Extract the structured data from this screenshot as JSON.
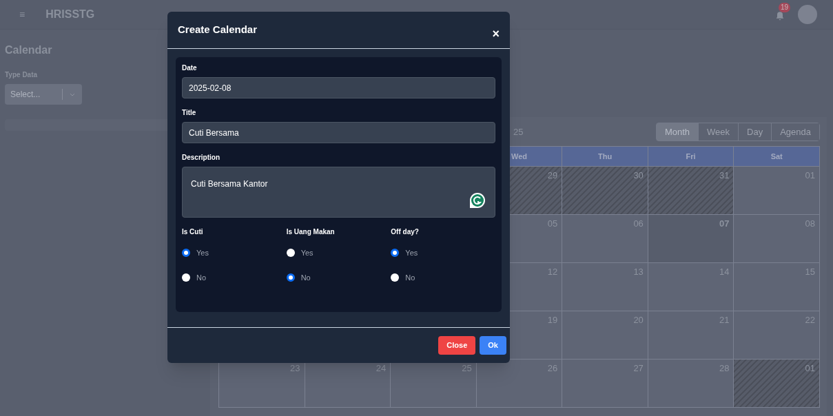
{
  "header": {
    "menu_glyph": "≡",
    "brand": "HRISSTG",
    "notification_count": "19"
  },
  "page": {
    "title": "Calendar",
    "filter_label": "Type Data",
    "filter_placeholder": "Select..."
  },
  "calendar": {
    "label": "25",
    "views": [
      {
        "label": "Month",
        "selected": true
      },
      {
        "label": "Week",
        "selected": false
      },
      {
        "label": "Day",
        "selected": false
      },
      {
        "label": "Agenda",
        "selected": false
      }
    ],
    "weekdays": [
      {
        "label": "Wed"
      },
      {
        "label": "Thu"
      },
      {
        "label": "Fri"
      },
      {
        "label": "Sat"
      }
    ],
    "weeks": [
      [
        {
          "day": "29",
          "outside": true,
          "today": false
        },
        {
          "day": "30",
          "outside": true,
          "today": false
        },
        {
          "day": "31",
          "outside": true,
          "today": false
        },
        {
          "day": "01",
          "outside": false,
          "today": false
        }
      ],
      [
        {
          "day": "05",
          "outside": false,
          "today": false
        },
        {
          "day": "06",
          "outside": false,
          "today": false
        },
        {
          "day": "07",
          "outside": false,
          "today": true
        },
        {
          "day": "08",
          "outside": false,
          "today": false
        }
      ],
      [
        {
          "day": "12",
          "outside": false,
          "today": false
        },
        {
          "day": "13",
          "outside": false,
          "today": false
        },
        {
          "day": "14",
          "outside": false,
          "today": false
        },
        {
          "day": "15",
          "outside": false,
          "today": false
        }
      ],
      [
        {
          "day": "19",
          "outside": false,
          "today": false
        },
        {
          "day": "20",
          "outside": false,
          "today": false
        },
        {
          "day": "21",
          "outside": false,
          "today": false
        },
        {
          "day": "22",
          "outside": false,
          "today": false
        }
      ],
      [
        {
          "day": "23",
          "outside": false,
          "today": false
        },
        {
          "day": "24",
          "outside": false,
          "today": false
        },
        {
          "day": "25",
          "outside": false,
          "today": false
        },
        {
          "day": "26",
          "outside": false,
          "today": false
        },
        {
          "day": "27",
          "outside": false,
          "today": false
        },
        {
          "day": "28",
          "outside": false,
          "today": false
        },
        {
          "day": "01",
          "outside": true,
          "today": false
        }
      ]
    ]
  },
  "dialog": {
    "title": "Create Calendar",
    "close_glyph": "×",
    "fields": [
      {
        "kind": "input",
        "label": "Date",
        "value": "2025-02-08"
      },
      {
        "kind": "input",
        "label": "Title",
        "value": "Cuti Bersama"
      },
      {
        "kind": "textarea",
        "label": "Description",
        "value": "Cuti Bersama Kantor"
      }
    ],
    "radio_groups": [
      {
        "label": "Is Cuti",
        "options": [
          {
            "label": "Yes",
            "selected": true
          },
          {
            "label": "No",
            "selected": false
          }
        ]
      },
      {
        "label": "Is Uang Makan",
        "options": [
          {
            "label": "Yes",
            "selected": false
          },
          {
            "label": "No",
            "selected": true
          }
        ]
      },
      {
        "label": "Off day?",
        "options": [
          {
            "label": "Yes",
            "selected": true
          },
          {
            "label": "No",
            "selected": false
          }
        ]
      }
    ],
    "buttons": [
      {
        "kind": "danger",
        "label": "Close"
      },
      {
        "kind": "primary",
        "label": "Ok"
      }
    ]
  }
}
